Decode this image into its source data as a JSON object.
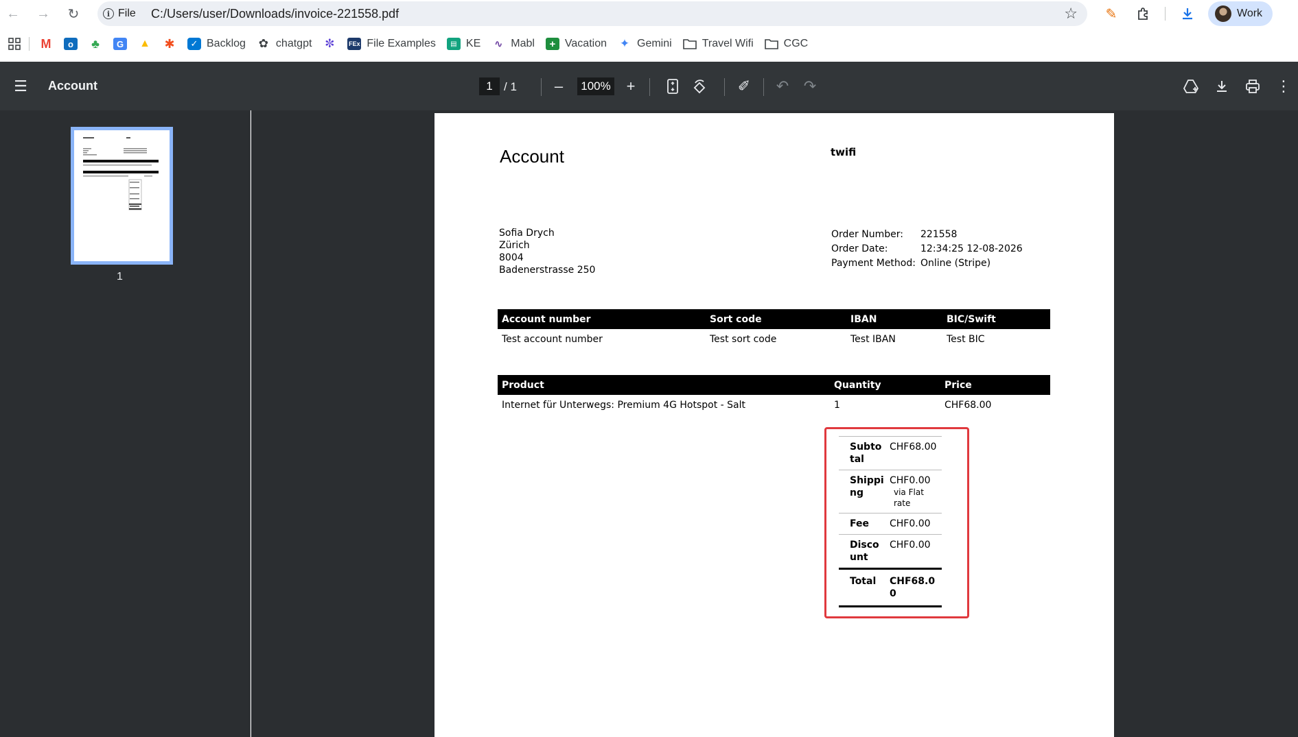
{
  "browser": {
    "site_chip": "File",
    "url": "C:/Users/user/Downloads/invoice-221558.pdf",
    "profile": "Work"
  },
  "bookmarks": [
    {
      "label": "",
      "icon": "gmail-icon"
    },
    {
      "label": "",
      "icon": "outlook-icon"
    },
    {
      "label": "",
      "icon": "clover-icon"
    },
    {
      "label": "",
      "icon": "translate-icon"
    },
    {
      "label": "",
      "icon": "drive-icon"
    },
    {
      "label": "",
      "icon": "figma-icon"
    },
    {
      "label": "Backlog",
      "icon": "azure-icon"
    },
    {
      "label": "chatgpt",
      "icon": "openai-icon"
    },
    {
      "label": "",
      "icon": "planet-icon"
    },
    {
      "label": "File Examples",
      "icon": "fex-icon"
    },
    {
      "label": "KE",
      "icon": "ke-icon"
    },
    {
      "label": "Mabl",
      "icon": "mabl-icon"
    },
    {
      "label": "Vacation",
      "icon": "sheets-icon"
    },
    {
      "label": "Gemini",
      "icon": "gemini-icon"
    },
    {
      "label": "Travel Wifi",
      "icon": "folder-icon"
    },
    {
      "label": "CGC",
      "icon": "folder-icon"
    }
  ],
  "pdf_toolbar": {
    "title": "Account",
    "page_current": "1",
    "page_total": "/  1",
    "zoom": "100%"
  },
  "sidebar": {
    "thumb_page_number": "1"
  },
  "invoice": {
    "title": "Account",
    "shop_name": "twifi",
    "address": [
      "Sofia Drych",
      "Zürich",
      "8004",
      "Badenerstrasse 250"
    ],
    "order": {
      "number_label": "Order Number:",
      "number": "221558",
      "date_label": "Order Date:",
      "date": "12:34:25 12-08-2026",
      "payment_label": "Payment Method:",
      "payment": "Online (Stripe)"
    },
    "bank": {
      "headers": [
        "Account number",
        "Sort code",
        "IBAN",
        "BIC/Swift"
      ],
      "row": [
        "Test account number",
        "Test sort code",
        "Test IBAN",
        "Test BIC"
      ]
    },
    "products": {
      "headers": [
        "Product",
        "Quantity",
        "Price"
      ],
      "row": [
        "Internet für Unterwegs: Premium 4G Hotspot - Salt",
        "1",
        "CHF68.00"
      ]
    },
    "totals": {
      "subtotal_label": "Subtotal",
      "subtotal": "CHF68.00",
      "shipping_label": "Shipping",
      "shipping": "CHF0.00",
      "shipping_via": "via Flat rate",
      "fee_label": "Fee",
      "fee": "CHF0.00",
      "discount_label": "Discount",
      "discount": "CHF0.00",
      "total_label": "Total",
      "total": "CHF68.00"
    }
  },
  "colors": {
    "toolbar_bg": "#323639",
    "viewer_bg": "#2b2e31",
    "thumb_border": "#8ab4f8",
    "highlight_box": "#e0393e",
    "profile_chip": "#d3e3fd"
  }
}
